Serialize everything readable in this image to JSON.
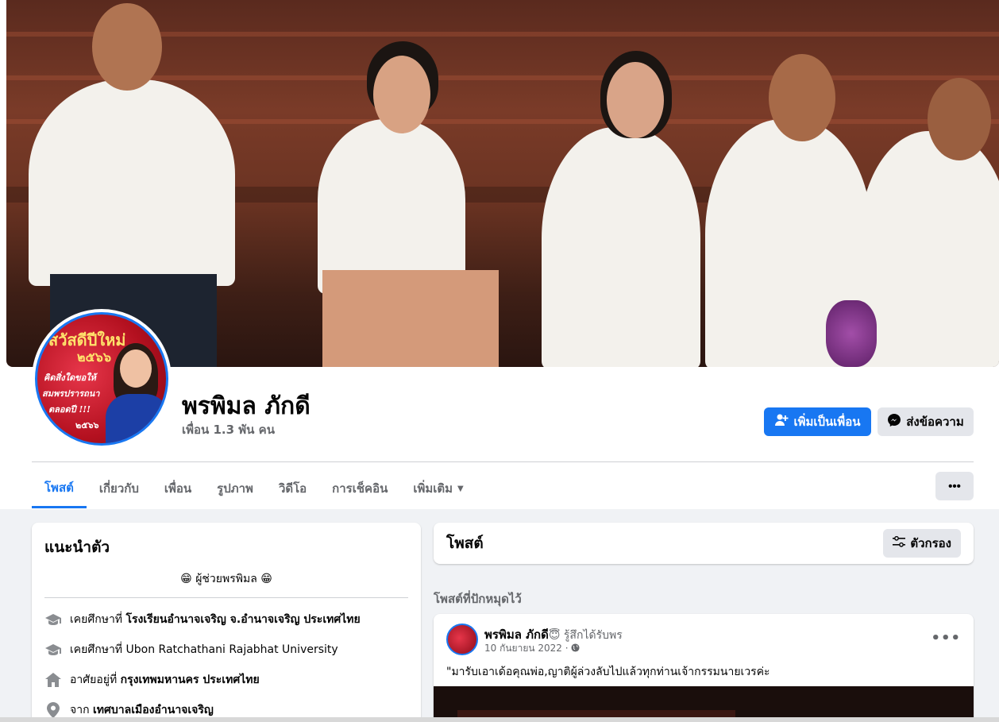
{
  "profile": {
    "name": "พรพิมล ภักดี",
    "friends": "เพื่อน 1.3 พัน คน",
    "avatar_text": [
      "สวัสดีปีใหม่",
      "๒๕๖๖",
      "คิดสิ่งใดขอให้",
      "สมพรปรารถนา",
      "ตลอดปี !!!",
      "๒๕๖๖"
    ]
  },
  "actions": {
    "add_friend": "เพิ่มเป็นเพื่อน",
    "message": "ส่งข้อความ",
    "more": "•••"
  },
  "tabs": [
    "โพสต์",
    "เกี่ยวกับ",
    "เพื่อน",
    "รูปภาพ",
    "วิดีโอ",
    "การเช็คอิน",
    "เพิ่มเติม"
  ],
  "intro": {
    "title": "แนะนำตัว",
    "bio": "😁 ผู้ช่วยพรพิมล 😁",
    "rows": [
      {
        "prefix": "เคยศึกษาที่",
        "value": "โรงเรียนอำนาจเจริญ จ.อำนาจเจริญ ประเทศไทย"
      },
      {
        "prefix": "เคยศึกษาที่",
        "value": "Ubon Ratchathani Rajabhat University"
      },
      {
        "prefix": "อาศัยอยู่ที่",
        "value": "กรุงเทพมหานคร ประเทศไทย"
      },
      {
        "prefix": "จาก",
        "value": "เทศบาลเมืองอำนาจเจริญ"
      }
    ]
  },
  "posts": {
    "title": "โพสต์",
    "filter": "ตัวกรอง",
    "pinned_label": "โพสต์ที่ปักหมุดไว้",
    "item": {
      "author": "พรพิมล ภักดี",
      "feeling": "😇 รู้สึกได้รับพร",
      "date": "10 กันยายน 2022 ·",
      "text": "\"มารับเอาเด้อคุณพ่อ,ญาติผู้ล่วงลับไปแล้วทุกท่านเจ้ากรรมนายเวรค่ะ"
    }
  },
  "colors": {
    "accent": "#1877f2",
    "background": "#f0f2f5",
    "secondary_text": "#65676b"
  }
}
